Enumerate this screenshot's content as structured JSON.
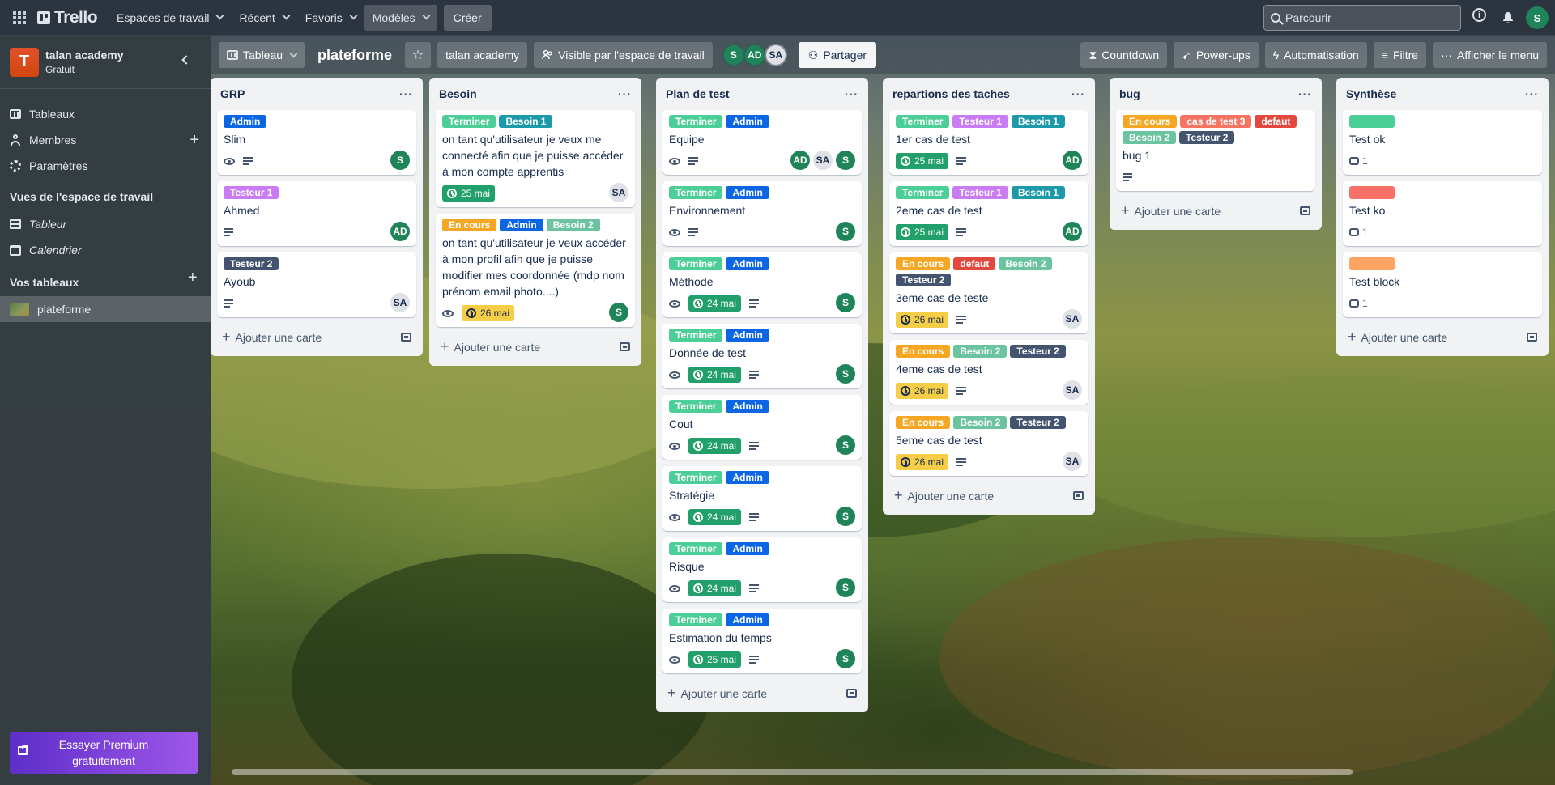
{
  "topnav": {
    "logo": "Trello",
    "menus": [
      "Espaces de travail",
      "Récent",
      "Favoris",
      "Modèles"
    ],
    "create": "Créer",
    "search_placeholder": "Parcourir",
    "user_initial": "S"
  },
  "sidebar": {
    "workspace_initial": "T",
    "workspace_name": "talan academy",
    "workspace_plan": "Gratuit",
    "items": [
      {
        "label": "Tableaux",
        "icon": "board-icon"
      },
      {
        "label": "Membres",
        "icon": "person-icon"
      },
      {
        "label": "Paramètres",
        "icon": "gear-icon"
      }
    ],
    "views_title": "Vues de l'espace de travail",
    "views": [
      {
        "label": "Tableur",
        "icon": "table-icon"
      },
      {
        "label": "Calendrier",
        "icon": "calendar-icon"
      }
    ],
    "boards_title": "Vos tableaux",
    "boards": [
      {
        "label": "plateforme"
      }
    ],
    "premium": "Essayer Premium gratuitement"
  },
  "board_header": {
    "view": "Tableau",
    "title": "plateforme",
    "workspace": "talan academy",
    "visibility": "Visible par l'espace de travail",
    "members": [
      "S",
      "AD",
      "SA"
    ],
    "share": "Partager",
    "countdown": "Countdown",
    "powerups": "Power-ups",
    "automation": "Automatisation",
    "filter": "Filtre",
    "menu": "Afficher le menu"
  },
  "colors": {
    "Admin": "#0c66e4",
    "Testeur 1": "#c97cf4",
    "Testeur 2": "#44546f",
    "Terminer": "#4bce97",
    "Besoin 1": "#1d9aaa",
    "Besoin 2": "#6cc3a0",
    "En cours": "#f5a623",
    "cas de test 3": "#f87462",
    "defaut": "#e2483d",
    "green": "#4bce97",
    "red": "#f87168",
    "orange": "#fea362"
  },
  "add_card": "Ajouter une carte",
  "lists": [
    {
      "title": "GRP",
      "cards": [
        {
          "labels": [
            "Admin"
          ],
          "title": "Slim",
          "watch": true,
          "desc": true,
          "members": [
            "S"
          ]
        },
        {
          "labels": [
            "Testeur 1"
          ],
          "title": "Ahmed",
          "desc": true,
          "members": [
            "AD"
          ]
        },
        {
          "labels": [
            "Testeur 2"
          ],
          "title": "Ayoub",
          "desc": true,
          "members": [
            "SA"
          ]
        }
      ]
    },
    {
      "title": "Besoin",
      "cards": [
        {
          "labels": [
            "Terminer",
            "Besoin 1"
          ],
          "title": "on tant qu'utilisateur je veux me connecté afin que je puisse accéder à mon compte apprentis",
          "due": "25 mai",
          "due_style": "green",
          "members": [
            "SA"
          ]
        },
        {
          "labels": [
            "En cours",
            "Admin",
            "Besoin 2"
          ],
          "title": "on tant qu'utilisateur je veux accéder à mon profil afin que je puisse modifier mes coordonnée (mdp nom prénom email photo....)",
          "watch": true,
          "due": "26 mai",
          "due_style": "yellow",
          "members": [
            "S"
          ]
        }
      ]
    },
    {
      "title": "Plan de test",
      "cards": [
        {
          "labels": [
            "Terminer",
            "Admin"
          ],
          "title": "Equipe",
          "watch": true,
          "desc": true,
          "members": [
            "AD",
            "SA",
            "S"
          ]
        },
        {
          "labels": [
            "Terminer",
            "Admin"
          ],
          "title": "Environnement",
          "watch": true,
          "desc": true,
          "members": [
            "S"
          ]
        },
        {
          "labels": [
            "Terminer",
            "Admin"
          ],
          "title": "Méthode",
          "watch": true,
          "due": "24 mai",
          "due_style": "green",
          "desc": true,
          "members": [
            "S"
          ]
        },
        {
          "labels": [
            "Terminer",
            "Admin"
          ],
          "title": "Donnée de test",
          "watch": true,
          "due": "24 mai",
          "due_style": "green",
          "desc": true,
          "members": [
            "S"
          ]
        },
        {
          "labels": [
            "Terminer",
            "Admin"
          ],
          "title": "Cout",
          "watch": true,
          "due": "24 mai",
          "due_style": "green",
          "desc": true,
          "members": [
            "S"
          ]
        },
        {
          "labels": [
            "Terminer",
            "Admin"
          ],
          "title": "Stratégie",
          "watch": true,
          "due": "24 mai",
          "due_style": "green",
          "desc": true,
          "members": [
            "S"
          ]
        },
        {
          "labels": [
            "Terminer",
            "Admin"
          ],
          "title": "Risque",
          "watch": true,
          "due": "24 mai",
          "due_style": "green",
          "desc": true,
          "members": [
            "S"
          ]
        },
        {
          "labels": [
            "Terminer",
            "Admin"
          ],
          "title": "Estimation du temps",
          "watch": true,
          "due": "25 mai",
          "due_style": "green",
          "desc": true,
          "members": [
            "S"
          ]
        }
      ]
    },
    {
      "title": "repartions des taches",
      "cards": [
        {
          "labels": [
            "Terminer",
            "Testeur 1",
            "Besoin 1"
          ],
          "title": "1er cas de test",
          "due": "25 mai",
          "due_style": "green",
          "desc": true,
          "members": [
            "AD"
          ]
        },
        {
          "labels": [
            "Terminer",
            "Testeur 1",
            "Besoin 1"
          ],
          "title": "2eme cas de test",
          "due": "25 mai",
          "due_style": "green",
          "desc": true,
          "members": [
            "AD"
          ]
        },
        {
          "labels": [
            "En cours",
            "defaut",
            "Besoin 2",
            "Testeur 2"
          ],
          "title": "3eme cas de teste",
          "due": "26 mai",
          "due_style": "yellow",
          "desc": true,
          "members": [
            "SA"
          ]
        },
        {
          "labels": [
            "En cours",
            "Besoin 2",
            "Testeur 2"
          ],
          "title": "4eme cas de test",
          "due": "26 mai",
          "due_style": "yellow",
          "desc": true,
          "members": [
            "SA"
          ]
        },
        {
          "labels": [
            "En cours",
            "Besoin 2",
            "Testeur 2"
          ],
          "title": "5eme cas de test",
          "due": "26 mai",
          "due_style": "yellow",
          "desc": true,
          "members": [
            "SA"
          ]
        }
      ]
    },
    {
      "title": "bug",
      "cards": [
        {
          "labels": [
            "En cours",
            "cas de test 3",
            "defaut",
            "Besoin 2",
            "Testeur 2"
          ],
          "title": "bug 1",
          "desc": true,
          "members": []
        }
      ]
    },
    {
      "title": "Synthèse",
      "cards": [
        {
          "blank_label": "green",
          "title": "Test ok",
          "comments": "1",
          "members": []
        },
        {
          "blank_label": "red",
          "title": "Test ko",
          "comments": "1",
          "members": []
        },
        {
          "blank_label": "orange",
          "title": "Test block",
          "comments": "1",
          "members": []
        }
      ]
    }
  ]
}
